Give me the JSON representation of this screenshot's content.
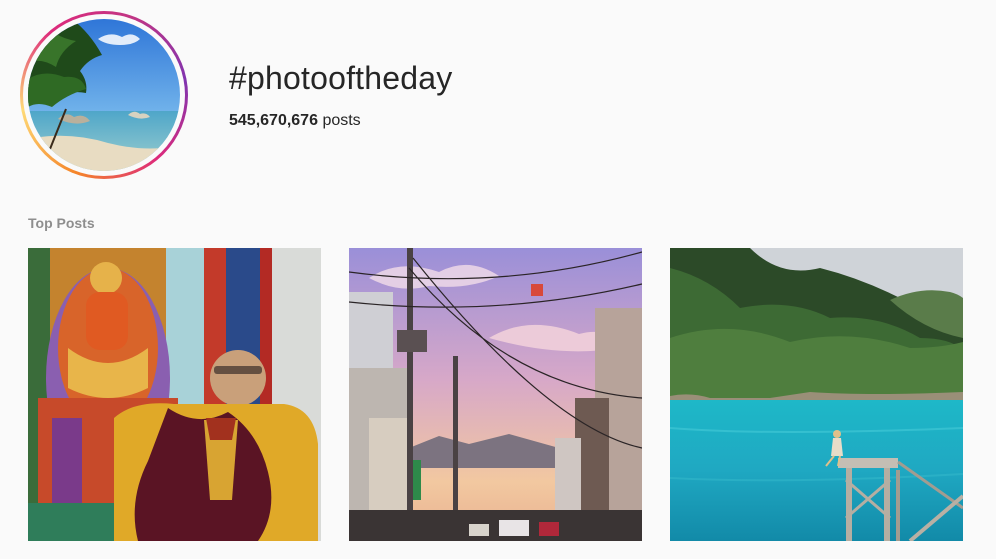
{
  "hashtag": {
    "title": "#photooftheday",
    "count": "545,670,676",
    "count_suffix": "posts",
    "avatar_ring_colors": [
      "#f58529",
      "#dd2a7b",
      "#8134af"
    ]
  },
  "sections": {
    "top_posts_label": "Top Posts"
  },
  "posts": [
    {
      "subject": "monk-thangka-photo"
    },
    {
      "subject": "street-power-lines-photo"
    },
    {
      "subject": "blue-lagoon-photo"
    }
  ]
}
